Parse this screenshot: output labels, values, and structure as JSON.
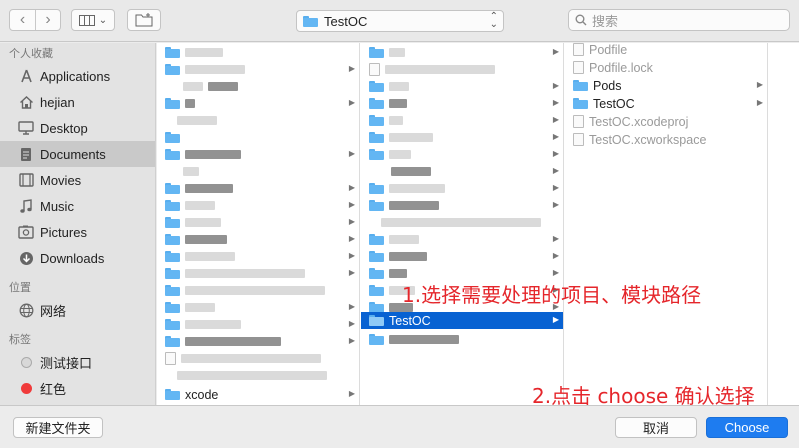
{
  "toolbar": {
    "back_icon": "chevron-left-icon",
    "forward_icon": "chevron-right-icon",
    "path_label": "TestOC",
    "search_placeholder": "搜索"
  },
  "sidebar": {
    "favorites_header": "个人收藏",
    "favorites": [
      {
        "label": "Applications",
        "icon": "applications-icon"
      },
      {
        "label": "hejian",
        "icon": "home-icon"
      },
      {
        "label": "Desktop",
        "icon": "desktop-icon"
      },
      {
        "label": "Documents",
        "icon": "documents-icon",
        "selected": true
      },
      {
        "label": "Movies",
        "icon": "movies-icon"
      },
      {
        "label": "Music",
        "icon": "music-icon"
      },
      {
        "label": "Pictures",
        "icon": "pictures-icon"
      },
      {
        "label": "Downloads",
        "icon": "downloads-icon"
      }
    ],
    "locations_header": "位置",
    "locations": [
      {
        "label": "网络",
        "icon": "network-icon"
      }
    ],
    "tags_header": "标签",
    "tags": [
      {
        "label": "测试接口",
        "color": "#d8d8d8"
      },
      {
        "label": "红色",
        "color": "#f03b3b"
      }
    ]
  },
  "column1": {
    "visible_label": "xcode"
  },
  "column2": {
    "selected_label": "TestOC"
  },
  "column3": {
    "items": [
      {
        "label": "Podfile",
        "kind": "doc",
        "dim": true
      },
      {
        "label": "Podfile.lock",
        "kind": "doc",
        "dim": true
      },
      {
        "label": "Pods",
        "kind": "folder",
        "dim": false
      },
      {
        "label": "TestOC",
        "kind": "folder",
        "dim": false
      },
      {
        "label": "TestOC.xcodeproj",
        "kind": "doc",
        "dim": true
      },
      {
        "label": "TestOC.xcworkspace",
        "kind": "doc",
        "dim": true
      }
    ]
  },
  "annotations": {
    "step1": "1.选择需要处理的项目、模块路径",
    "step2": "2.点击 choose 确认选择"
  },
  "bottom": {
    "new_folder": "新建文件夹",
    "cancel": "取消",
    "choose": "Choose"
  },
  "colors": {
    "selection": "#0862d2",
    "annotation": "#e5262b",
    "primary_button": "#1e7cf0"
  }
}
